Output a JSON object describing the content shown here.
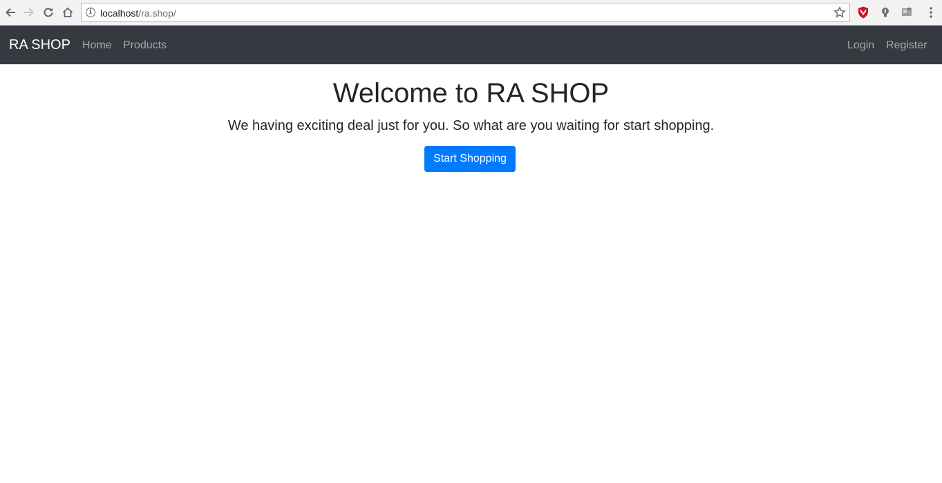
{
  "browser": {
    "url_host": "localhost",
    "url_path": "/ra.shop/"
  },
  "navbar": {
    "brand": "RA SHOP",
    "links": [
      "Home",
      "Products"
    ],
    "right_links": [
      "Login",
      "Register"
    ],
    "background": "#343a40"
  },
  "hero": {
    "title": "Welcome to RA SHOP",
    "lead": "We having exciting deal just for you. So what are you waiting for start shopping.",
    "button_label": "Start Shopping",
    "button_color": "#007bff"
  },
  "icons": [
    "back-icon",
    "forward-icon",
    "reload-icon",
    "home-icon",
    "info-icon",
    "star-icon",
    "shield-extension-icon",
    "bulb-extension-icon",
    "gray-extension-icon",
    "menu-dots-icon"
  ]
}
